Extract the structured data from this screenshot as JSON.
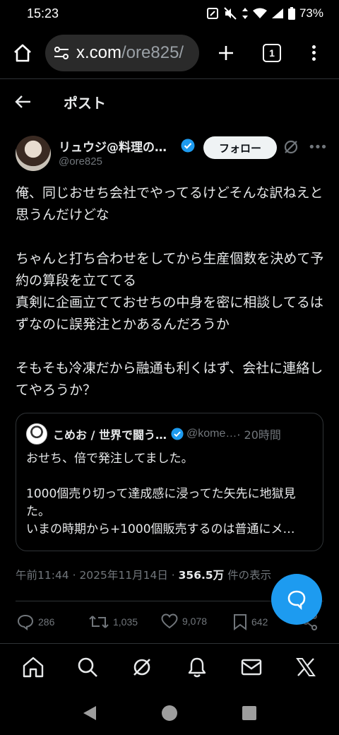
{
  "status_bar": {
    "time": "15:23",
    "battery": "73%",
    "icons": [
      "nfc-icon",
      "mute-icon",
      "data-arrows-icon",
      "wifi-icon",
      "signal-icon",
      "battery-icon"
    ]
  },
  "browser": {
    "url_main": "x.com",
    "url_path": "/ore825/",
    "tab_count": "1",
    "icons": [
      "home-icon",
      "site-settings-icon",
      "new-tab-icon",
      "tab-switcher-icon",
      "more-icon"
    ]
  },
  "header": {
    "title": "ポスト"
  },
  "post": {
    "author_name": "リュウジ@料理の…",
    "author_handle": "@ore825",
    "follow_label": "フォロー",
    "text": "俺、同じおせち会社でやってるけどそんな訳ねえと思うんだけどな\n\nちゃんと打ち合わせをしてから生産個数を決めて予約の算段を立ててる\n真剣に企画立てておせちの中身を密に相談してるはずなのに誤発注とかあるんだろうか\n\nそもそも冷凍だから融通も利くはず、会社に連絡してやろうか？",
    "quote": {
      "name": "こめお / 世界で闘う…",
      "handle": "@kome…",
      "time": "· 20時間",
      "text": "おせち、倍で発注してました。\n\n1000個売り切って達成感に浸ってた矢先に地獄見た。\nいまの時期から+1000個販売するのは普通にメ…"
    },
    "meta_time": "午前11:44 · 2025年11月14日 · ",
    "meta_views": "356.5万",
    "meta_views_suffix": " 件の表示",
    "stats": {
      "replies": "286",
      "reposts": "1,035",
      "likes": "9,078",
      "bookmarks": "642"
    }
  },
  "colors": {
    "background": "#000000",
    "text": "#e7e9ea",
    "muted": "#71767b",
    "accent": "#1d9bf0",
    "border": "#2f3336"
  },
  "bottom_nav": [
    "home-icon",
    "search-icon",
    "grok-icon",
    "notifications-icon",
    "messages-icon",
    "x-logo-icon"
  ],
  "system_nav": [
    "back-icon",
    "home-circle-icon",
    "recents-icon"
  ]
}
